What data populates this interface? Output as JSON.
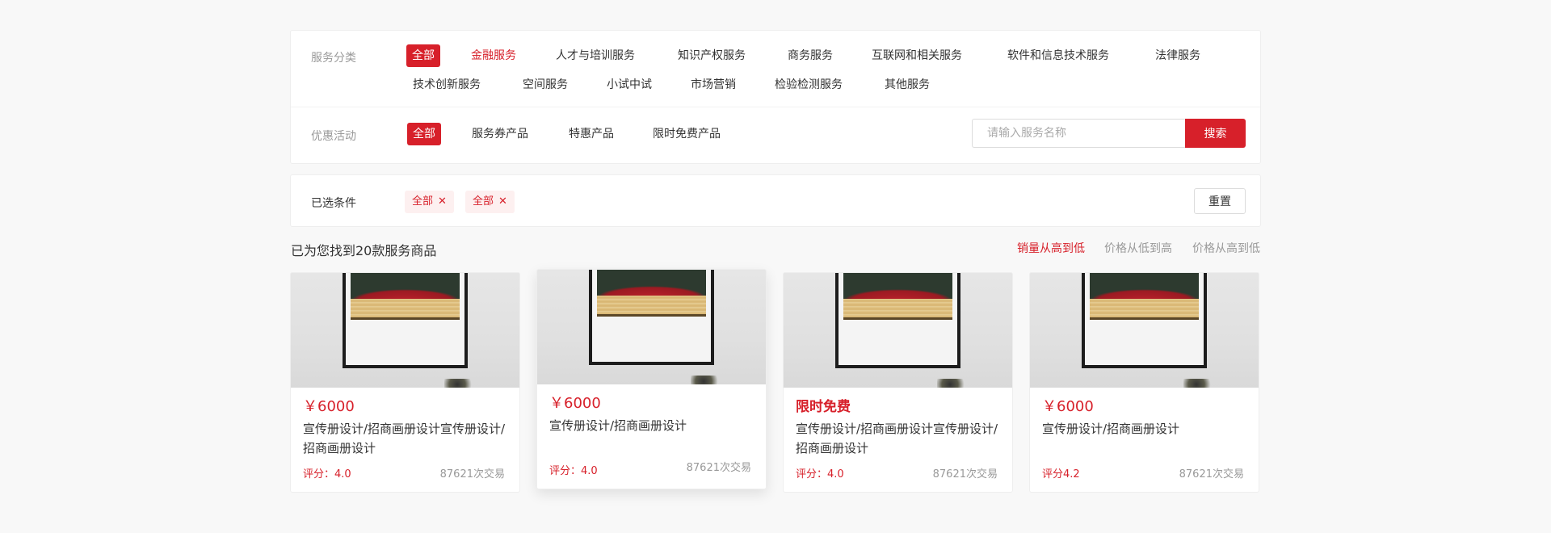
{
  "filters": {
    "category_label": "服务分类",
    "categories": [
      "全部",
      "金融服务",
      "人才与培训服务",
      "知识产权服务",
      "商务服务",
      "互联网和相关服务",
      "软件和信息技术服务",
      "法律服务",
      "技术创新服务",
      "空间服务",
      "小试中试",
      "市场营销",
      "检验检测服务",
      "其他服务"
    ],
    "promo_label": "优惠活动",
    "promos": [
      "全部",
      "服务券产品",
      "特惠产品",
      "限时免费产品"
    ],
    "search_placeholder": "请输入服务名称",
    "search_button": "搜索"
  },
  "selected": {
    "label": "已选条件",
    "tags": [
      "全部",
      "全部"
    ],
    "remove_glyph": "✕",
    "reset_button": "重置"
  },
  "results": {
    "count_text": "已为您找到20款服务商品",
    "sorts": [
      "销量从高到低",
      "价格从低到高",
      "价格从高到低"
    ]
  },
  "cards": [
    {
      "price": "￥6000",
      "title": "宣传册设计/招商画册设计宣传册设计/招商画册设计",
      "rating": "评分：4.0",
      "deals": "87621次交易"
    },
    {
      "price": "￥6000",
      "title": "宣传册设计/招商画册设计",
      "rating": "评分：4.0",
      "deals": "87621次交易"
    },
    {
      "price": "限时免费",
      "title": "宣传册设计/招商画册设计宣传册设计/招商画册设计",
      "rating": "评分：4.0",
      "deals": "87621次交易"
    },
    {
      "price": "￥6000",
      "title": "宣传册设计/招商画册设计",
      "rating": "评分4.2",
      "deals": "87621次交易"
    }
  ],
  "colors": {
    "accent": "#d7202a",
    "muted": "#999999",
    "background": "#f8f8f8"
  },
  "icons": {
    "remove_tag": "close-icon"
  }
}
